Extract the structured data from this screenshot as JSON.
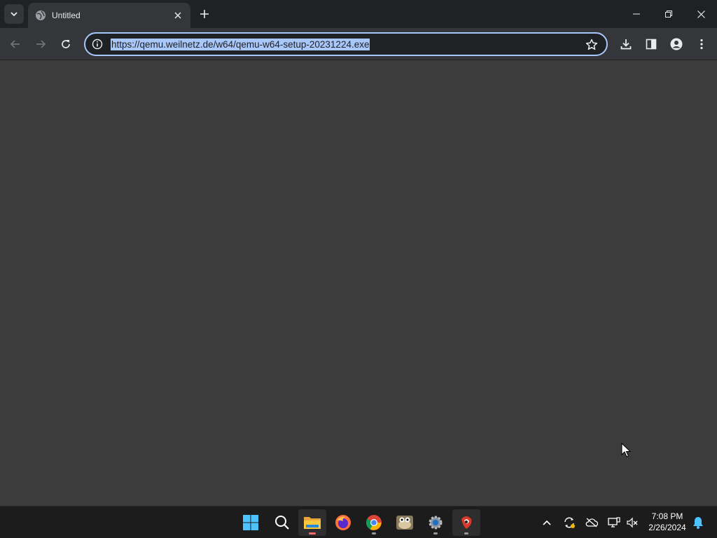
{
  "browser": {
    "tab_title": "Untitled",
    "url": "https://qemu.weilnetz.de/w64/qemu-w64-setup-20231224.exe"
  },
  "taskbar": {
    "apps": [
      "windows-start",
      "search",
      "file-explorer",
      "firefox",
      "chrome",
      "gimp-like-app",
      "settings",
      "app-red"
    ],
    "time": "7:08 PM",
    "date": "2/26/2024"
  },
  "colors": {
    "titlebar": "#202124",
    "toolbar": "#35363a",
    "content": "#3c3c3c",
    "taskbar": "#1c1c1c",
    "url_highlight": "#a8c7fa"
  }
}
